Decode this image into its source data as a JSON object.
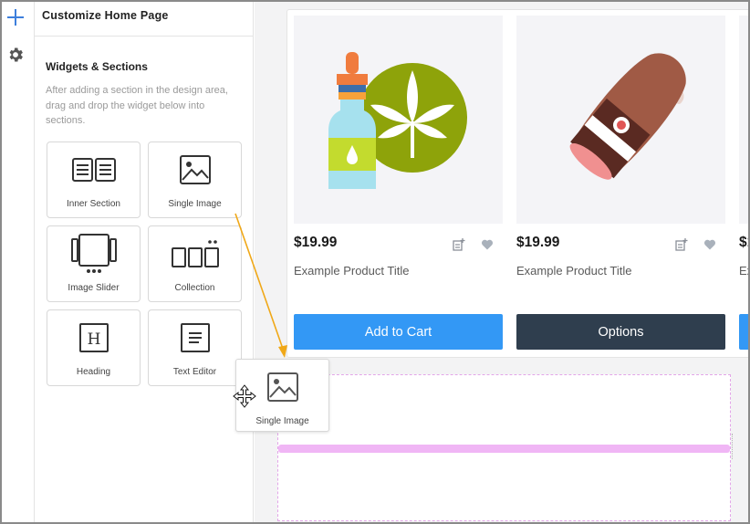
{
  "header": {
    "title": "Customize Home Page"
  },
  "rail": {
    "add_icon": "plus-icon",
    "settings_icon": "gear-icon"
  },
  "panel": {
    "section_title": "Widgets & Sections",
    "description": "After adding a section in the design area, drag and drop the widget below into sections.",
    "widgets": [
      {
        "label": "Inner Section",
        "icon": "inner-section-icon"
      },
      {
        "label": "Single Image",
        "icon": "image-icon"
      },
      {
        "label": "Image Slider",
        "icon": "image-slider-icon"
      },
      {
        "label": "Collection",
        "icon": "collection-icon"
      },
      {
        "label": "Heading",
        "icon": "heading-icon"
      },
      {
        "label": "Text Editor",
        "icon": "text-editor-icon"
      }
    ]
  },
  "products": [
    {
      "price": "$19.99",
      "title": "Example Product Title",
      "button": "Add to Cart",
      "image": "cbd-oil-cannabis-image"
    },
    {
      "price": "$19.99",
      "title": "Example Product Title",
      "button": "Options",
      "image": "cigar-image"
    },
    {
      "price": "$1",
      "title": "Ex",
      "button": "",
      "image": ""
    }
  ],
  "drag": {
    "label": "Single Image",
    "icon": "image-icon"
  },
  "colors": {
    "accent_blue": "#3398f5",
    "dark_button": "#2f3e4e",
    "drop_highlight": "#f0b6f5",
    "arrow": "#f0a818",
    "rail_plus": "#3d7fdc"
  }
}
